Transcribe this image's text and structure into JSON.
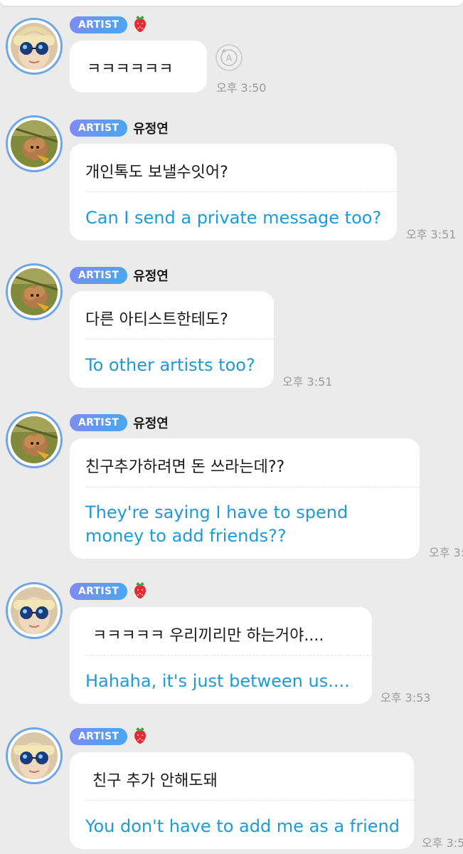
{
  "chat": {
    "badge_label": "ARTIST",
    "messages": [
      {
        "sender": "",
        "korean": "ㅋㅋㅋㅋㅋㅋ",
        "english": "",
        "time": "오후 3:50"
      },
      {
        "sender": "유정연",
        "korean": "개인톡도 보낼수잇어?",
        "english": "Can I send a private message too?",
        "time": "오후 3:51"
      },
      {
        "sender": "유정연",
        "korean": "다른 아티스트한테도?",
        "english": "To other artists too?",
        "time": "오후 3:51"
      },
      {
        "sender": "유정연",
        "korean": "친구추가하려면 돈 쓰라는데??",
        "english_lines": [
          "They're saying I have to spend",
          "money to add friends??"
        ],
        "time": "오후 3:"
      },
      {
        "sender": "",
        "korean": "ㅋㅋㅋㅋㅋ 우리끼리만 하는거야....",
        "english": "Hahaha, it's just between us....",
        "time": "오후 3:53"
      },
      {
        "sender": "",
        "korean": "친구 추가 안해도돼",
        "english": "You don't have to add me as a friend",
        "time": "오후 3:5"
      }
    ]
  },
  "icons": {
    "artist_emoji": "strawberry-icon",
    "translate": "translate-icon",
    "artist_avatar": "artist-avatar-icon",
    "fan_avatar": "dog-avatar-icon"
  },
  "colors": {
    "background": "#ebebeb",
    "bubble": "#ffffff",
    "translation_text": "#1e9ad6",
    "badge_gradient_start": "#7c8cf0",
    "badge_gradient_end": "#4aa6f0",
    "avatar_ring": "#6fa6e8",
    "timestamp": "#9a9a9a"
  }
}
